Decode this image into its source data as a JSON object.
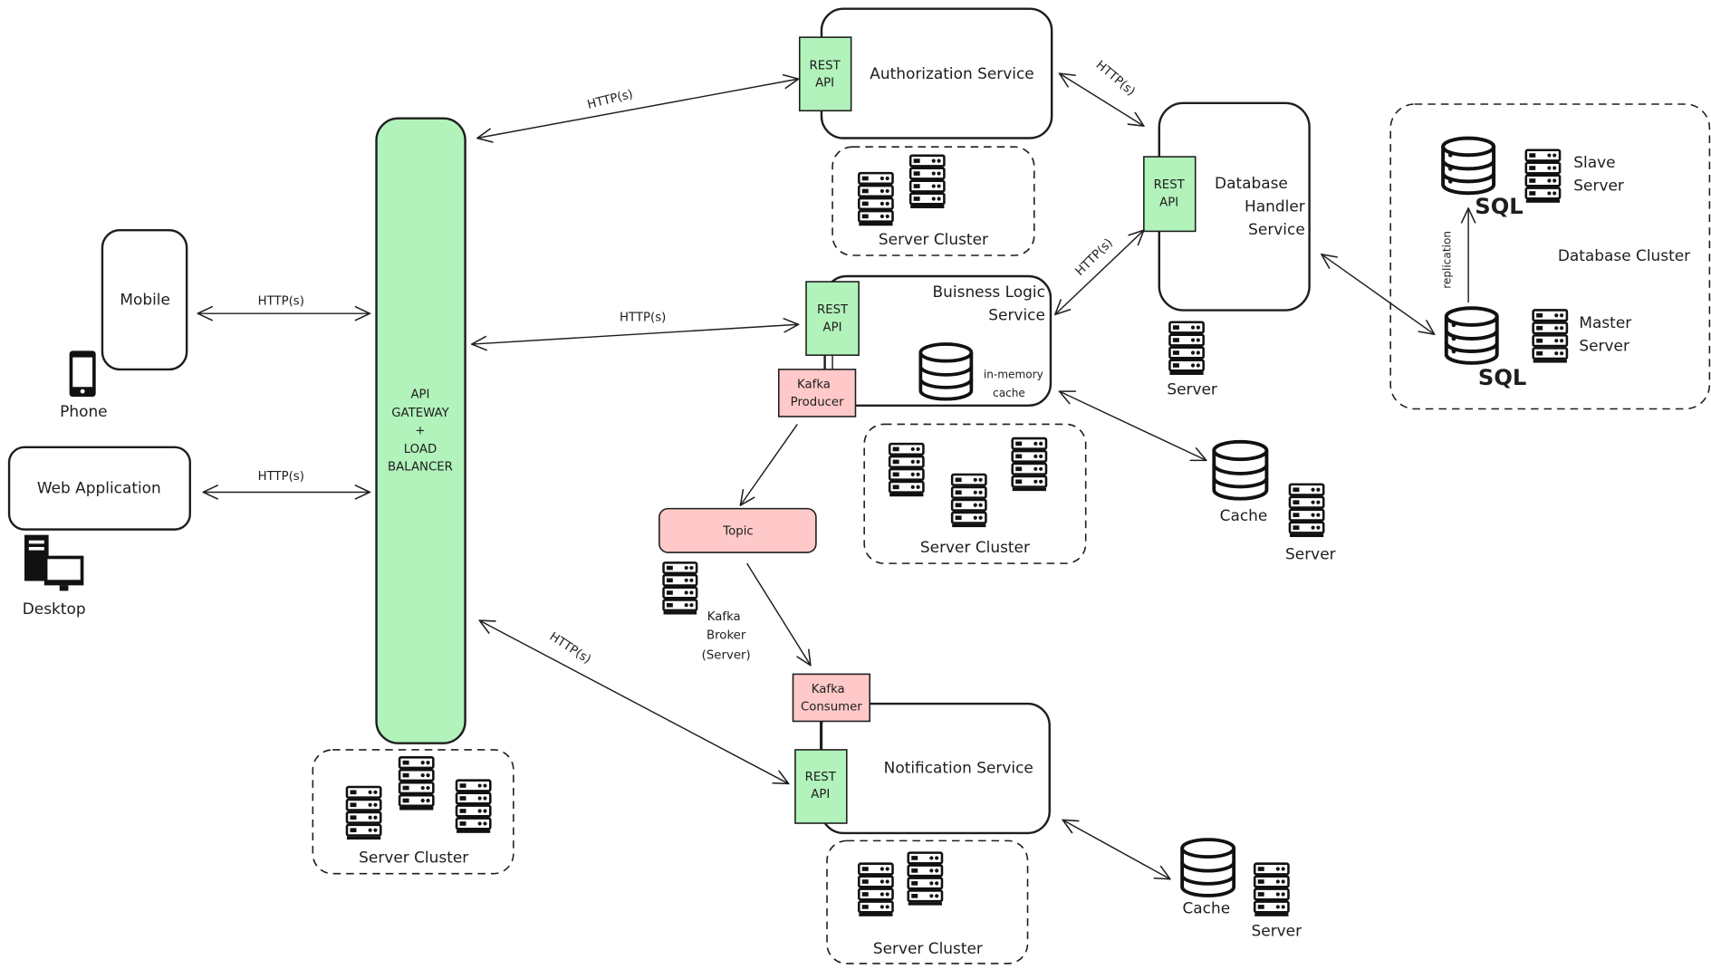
{
  "colors": {
    "rest_api": "#b2f2bb",
    "kafka": "#ffc9c9",
    "stroke": "#1e1e1e",
    "background": "#ffffff"
  },
  "clients": {
    "mobile": {
      "label": "Mobile",
      "device": "Phone",
      "icon": "phone-icon"
    },
    "web": {
      "label": "Web Application",
      "device": "Desktop",
      "icon": "desktop-icon"
    }
  },
  "gateway": {
    "lines": [
      "API",
      "GATEWAY",
      "+",
      "LOAD",
      "BALANCER"
    ]
  },
  "protocol": "HTTP(s)",
  "rest_api": [
    "REST",
    "API"
  ],
  "services": {
    "auth": "Authorization Service",
    "database": [
      "Database",
      "Handler",
      "Service"
    ],
    "business": [
      "Buisness Logic",
      "Service"
    ],
    "in_memory_cache": [
      "in-memory",
      "cache"
    ],
    "notification": "Notification Service"
  },
  "kafka": {
    "producer": [
      "Kafka",
      "Producer"
    ],
    "consumer": [
      "Kafka",
      "Consumer"
    ],
    "topic": "Topic",
    "broker": [
      "Kafka",
      "Broker",
      "(Server)"
    ]
  },
  "server_cluster": "Server Cluster",
  "server": "Server",
  "cache": "Cache",
  "database_cluster": {
    "label": "Database Cluster",
    "sql": "SQL",
    "slave": [
      "Slave",
      "Server"
    ],
    "master": [
      "Master",
      "Server"
    ],
    "replication": "replication"
  }
}
